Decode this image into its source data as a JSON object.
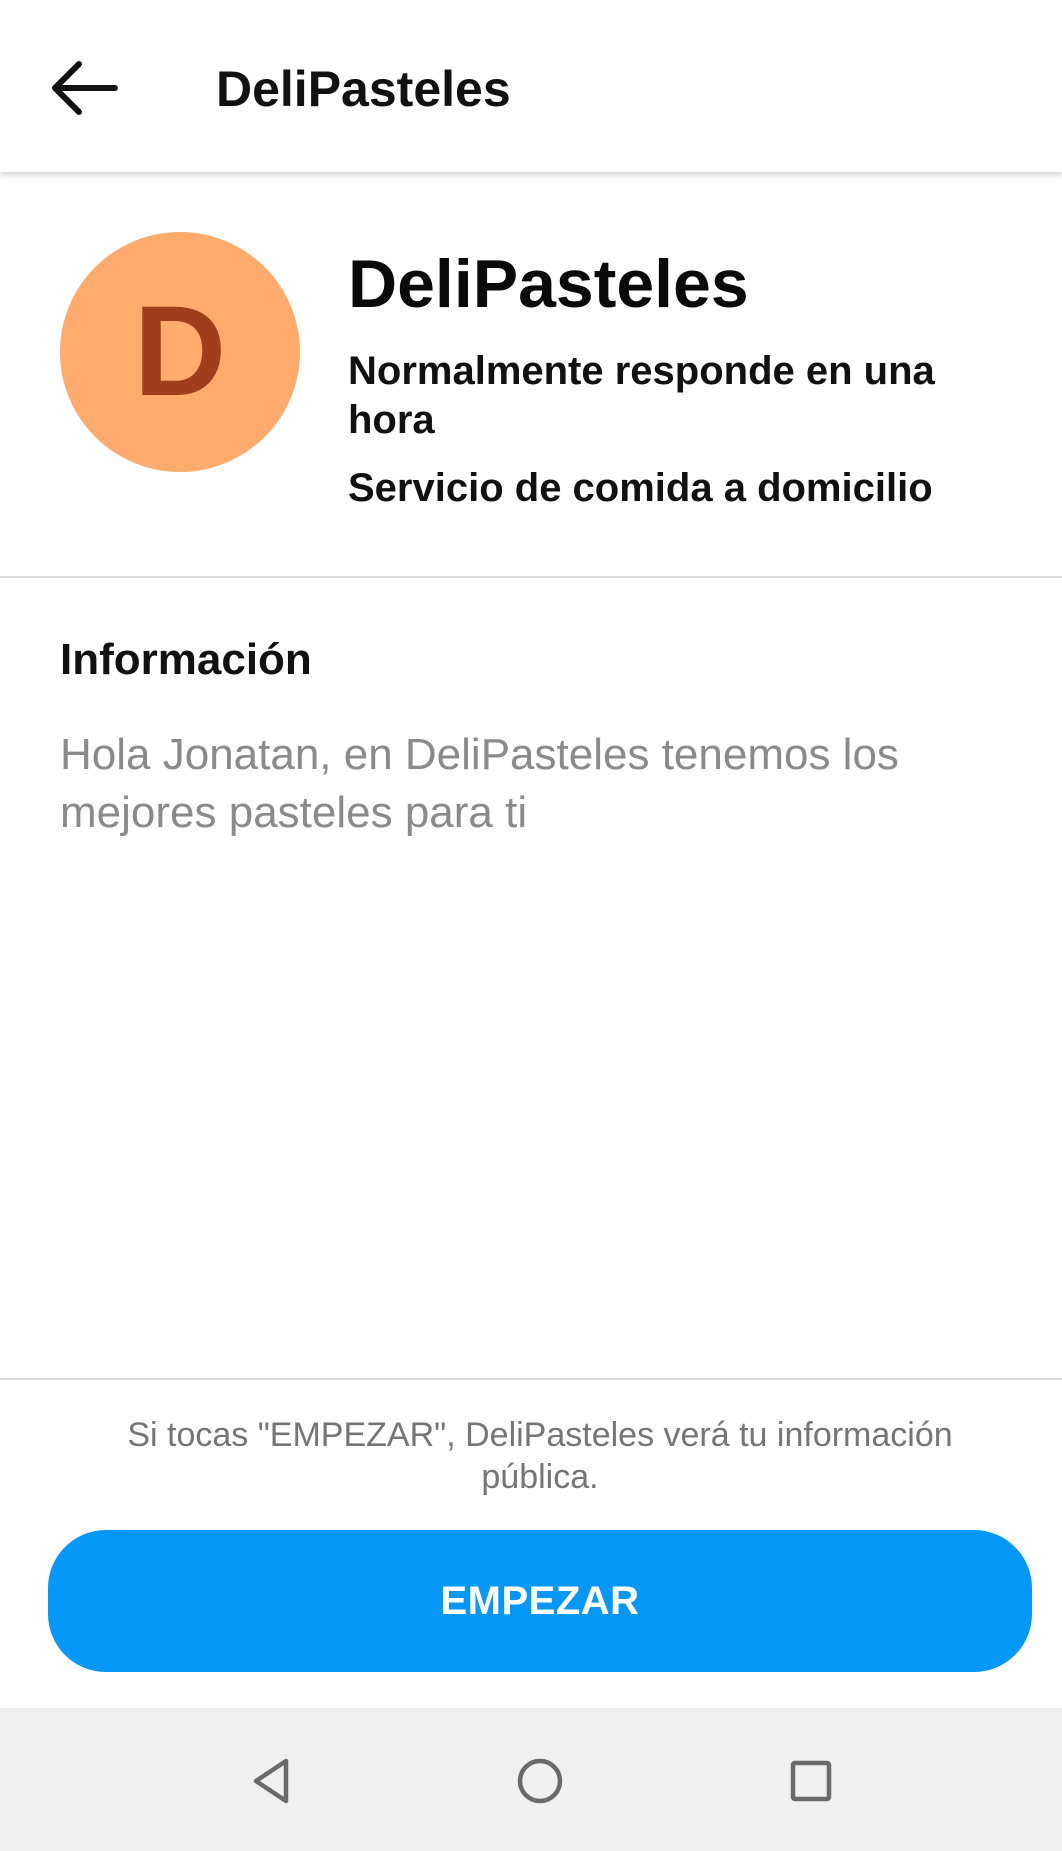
{
  "app_bar": {
    "title": "DeliPasteles",
    "back_icon": "arrow-left-icon"
  },
  "profile": {
    "avatar_letter": "D",
    "avatar_color": "#ffab6e",
    "avatar_letter_color": "#a23d1c",
    "name": "DeliPasteles",
    "response_time": "Normalmente responde en una hora",
    "category": "Servicio de comida a domicilio"
  },
  "info": {
    "heading": "Información",
    "text": "Hola Jonatan, en DeliPasteles tenemos los mejores pasteles para ti"
  },
  "footer": {
    "note": "Si tocas \"EMPEZAR\", DeliPasteles verá tu información pública.",
    "start_label": "EMPEZAR",
    "start_color": "#0698f8"
  },
  "nav_bar": {
    "back_icon": "triangle-back-icon",
    "home_icon": "circle-home-icon",
    "recents_icon": "square-recents-icon"
  }
}
